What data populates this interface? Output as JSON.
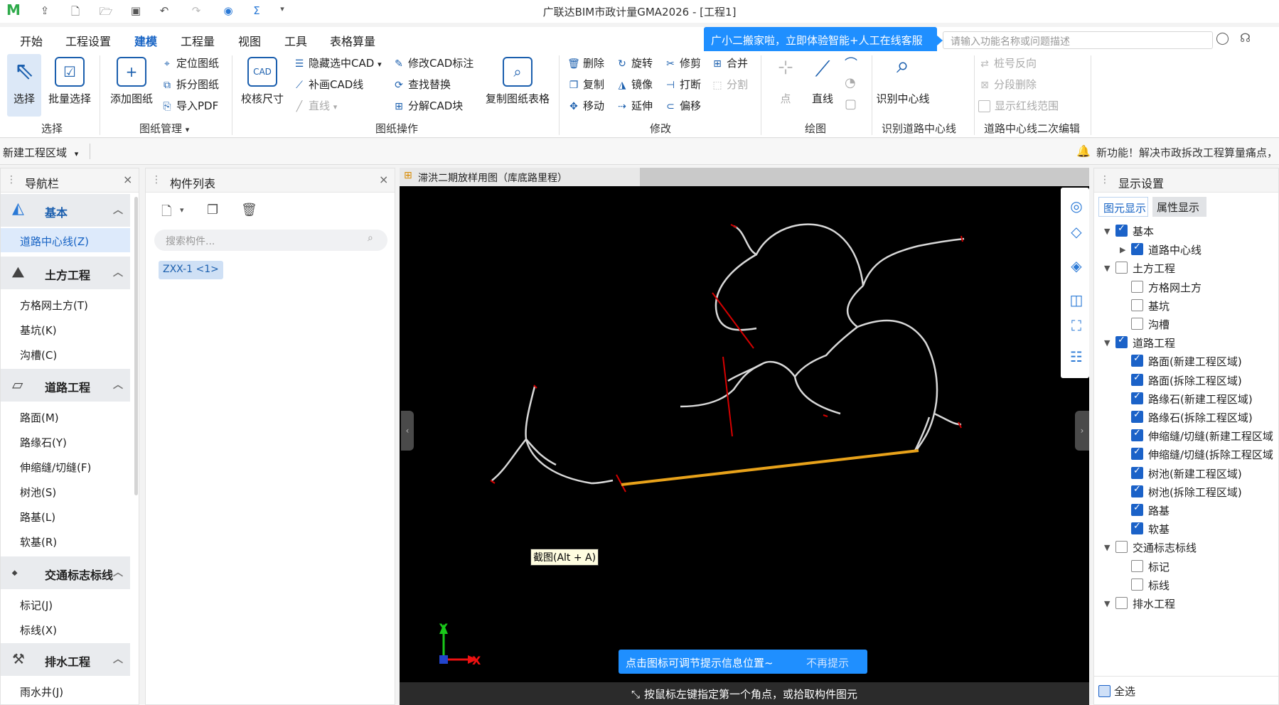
{
  "title_bar": {
    "logo": "M",
    "app_title": "广联达BIM市政计量GMA2026 - [工程1]"
  },
  "menu": {
    "items": [
      "开始",
      "工程设置",
      "建模",
      "工程量",
      "视图",
      "工具",
      "表格算量"
    ],
    "active": "建模",
    "banner": "广小二搬家啦，立即体验智能+人工在线客服",
    "search_placeholder": "请输入功能名称或问题描述"
  },
  "ribbon": {
    "select": {
      "select": "选择",
      "batch_select": "批量选择",
      "group": "选择"
    },
    "drawing_mgmt": {
      "add_drawing": "添加图纸",
      "locate": "定位图纸",
      "split": "拆分图纸",
      "import_pdf": "导入PDF",
      "group": "图纸管理"
    },
    "drawing_ops": {
      "calibrate": "校核尺寸",
      "hide_cad": "隐藏选中CAD",
      "redraw_cad": "补画CAD线",
      "line": "直线",
      "edit_cad_dim": "修改CAD标注",
      "find_replace": "查找替换",
      "explode_cad": "分解CAD块",
      "copy_table": "复制图纸表格",
      "group": "图纸操作"
    },
    "modify": {
      "delete": "删除",
      "rotate": "旋转",
      "trim": "修剪",
      "merge": "合并",
      "copy": "复制",
      "mirror": "镜像",
      "break": "打断",
      "split": "分割",
      "move": "移动",
      "extend": "延伸",
      "offset": "偏移",
      "group": "修改"
    },
    "draw": {
      "point": "点",
      "line": "直线",
      "group": "绘图"
    },
    "identify": {
      "identify_centerline": "识别中心线",
      "group": "识别道路中心线"
    },
    "secondary_edit": {
      "reverse_station": "桩号反向",
      "segment_delete": "分段删除",
      "show_redline": "显示红线范围",
      "group": "道路中心线二次编辑"
    }
  },
  "toolbar2": {
    "area_select": "新建工程区域",
    "notice": "新功能！解决市政拆改工程算量痛点，"
  },
  "nav": {
    "title": "导航栏",
    "categories": [
      {
        "label": "基本",
        "items": [
          "道路中心线(Z)"
        ]
      },
      {
        "label": "土方工程",
        "items": [
          "方格网土方(T)",
          "基坑(K)",
          "沟槽(C)"
        ]
      },
      {
        "label": "道路工程",
        "items": [
          "路面(M)",
          "路缘石(Y)",
          "伸缩缝/切缝(F)",
          "树池(S)",
          "路基(L)",
          "软基(R)"
        ]
      },
      {
        "label": "交通标志标线",
        "items": [
          "标记(J)",
          "标线(X)"
        ]
      },
      {
        "label": "排水工程",
        "items": [
          "雨水井(J)"
        ]
      }
    ],
    "selected": "道路中心线(Z)"
  },
  "component_list": {
    "title": "构件列表",
    "search_placeholder": "搜索构件...",
    "items": [
      "ZXX-1 <1>"
    ]
  },
  "drawing": {
    "tab_title": "滞洪二期放样用图（库底路里程）",
    "tooltip": "截图(Alt + A)",
    "hint_text": "点击图标可调节提示信息位置~",
    "hint_dismiss": "不再提示",
    "status": "按鼠标左键指定第一个角点，或拾取构件图元",
    "axis_x": "X",
    "axis_y": "Y"
  },
  "display_settings": {
    "title": "显示设置",
    "tabs": [
      "图元显示",
      "属性显示"
    ],
    "rows": [
      {
        "label": "基本",
        "level": 0,
        "checked": true
      },
      {
        "label": "道路中心线",
        "level": 1,
        "checked": true
      },
      {
        "label": "土方工程",
        "level": 0,
        "checked": false
      },
      {
        "label": "方格网土方",
        "level": 1,
        "checked": false
      },
      {
        "label": "基坑",
        "level": 1,
        "checked": false
      },
      {
        "label": "沟槽",
        "level": 1,
        "checked": false
      },
      {
        "label": "道路工程",
        "level": 0,
        "checked": true
      },
      {
        "label": "路面(新建工程区域)",
        "level": 1,
        "checked": true
      },
      {
        "label": "路面(拆除工程区域)",
        "level": 1,
        "checked": true
      },
      {
        "label": "路缘石(新建工程区域)",
        "level": 1,
        "checked": true
      },
      {
        "label": "路缘石(拆除工程区域)",
        "level": 1,
        "checked": true
      },
      {
        "label": "伸缩缝/切缝(新建工程区域",
        "level": 1,
        "checked": true
      },
      {
        "label": "伸缩缝/切缝(拆除工程区域",
        "level": 1,
        "checked": true
      },
      {
        "label": "树池(新建工程区域)",
        "level": 1,
        "checked": true
      },
      {
        "label": "树池(拆除工程区域)",
        "level": 1,
        "checked": true
      },
      {
        "label": "路基",
        "level": 1,
        "checked": true
      },
      {
        "label": "软基",
        "level": 1,
        "checked": true
      },
      {
        "label": "交通标志标线",
        "level": 0,
        "checked": false
      },
      {
        "label": "标记",
        "level": 1,
        "checked": false
      },
      {
        "label": "标线",
        "level": 1,
        "checked": false
      },
      {
        "label": "排水工程",
        "level": 0,
        "checked": false
      }
    ],
    "select_all": "全选"
  },
  "colors": {
    "accent": "#1763c4",
    "centerline": "#e8a21a",
    "cad_red": "#d40000"
  }
}
